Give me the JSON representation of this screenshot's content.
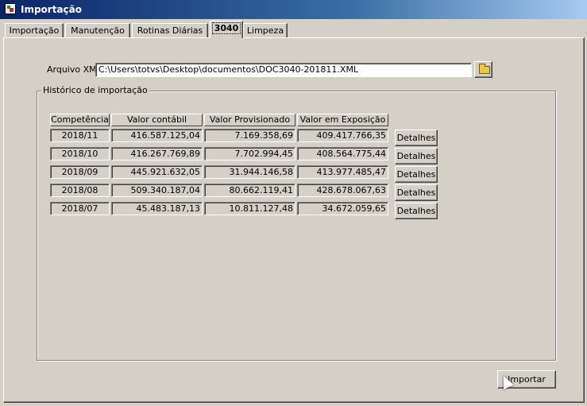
{
  "window": {
    "title": "Importação"
  },
  "tabs": [
    {
      "label": "Importação",
      "active": false
    },
    {
      "label": "Manutenção",
      "active": false
    },
    {
      "label": "Rotinas Diárias",
      "active": false
    },
    {
      "label": "3040",
      "active": true
    },
    {
      "label": "Limpeza",
      "active": false
    }
  ],
  "file": {
    "label": "Arquivo XML",
    "value": "C:\\Users\\totvs\\Desktop\\documentos\\DOC3040-201811.XML",
    "browse_icon": "folder-icon"
  },
  "history": {
    "title": "Histórico de importação",
    "columns": [
      "Competência",
      "Valor contábil",
      "Valor Provisionado",
      "Valor em Exposição"
    ],
    "rows": [
      {
        "competencia": "2018/11",
        "contabil": "416.587.125,04",
        "provisionado": "7.169.358,69",
        "exposicao": "409.417.766,35",
        "action": "Detalhes"
      },
      {
        "competencia": "2018/10",
        "contabil": "416.267.769,89",
        "provisionado": "7.702.994,45",
        "exposicao": "408.564.775,44",
        "action": "Detalhes"
      },
      {
        "competencia": "2018/09",
        "contabil": "445.921.632,05",
        "provisionado": "31.944.146,58",
        "exposicao": "413.977.485,47",
        "action": "Detalhes"
      },
      {
        "competencia": "2018/08",
        "contabil": "509.340.187,04",
        "provisionado": "80.662.119,41",
        "exposicao": "428.678.067,63",
        "action": "Detalhes"
      },
      {
        "competencia": "2018/07",
        "contabil": "45.483.187,13",
        "provisionado": "10.811.127,48",
        "exposicao": "34.672.059,65",
        "action": "Detalhes"
      }
    ]
  },
  "actions": {
    "import_label": "Importar"
  }
}
